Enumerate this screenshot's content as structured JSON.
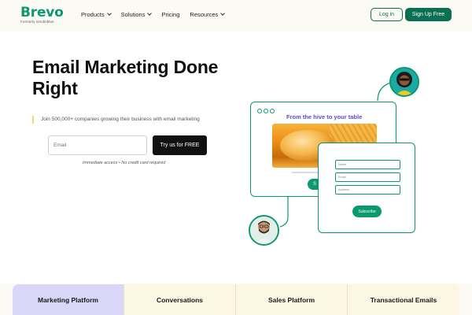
{
  "nav": {
    "logo": "Brevo",
    "logo_sub": "Formerly sendinblue",
    "menu": [
      {
        "label": "Products"
      },
      {
        "label": "Solutions"
      },
      {
        "label": "Pricing"
      },
      {
        "label": "Resources"
      }
    ],
    "login_label": "Log in",
    "signup_label": "Sign Up Free"
  },
  "hero": {
    "title": "Email Marketing Done Right",
    "tagline": "Join 500,000+ companies growing their business with email marketing",
    "email_placeholder": "Email",
    "cta_label": "Try us for FREE",
    "note": "Immediate access • No credit card required"
  },
  "illustration": {
    "card_title": "From the hive to your table",
    "card_button": "S",
    "form_fields": [
      "Name",
      "Email",
      "Address"
    ],
    "subscribe_label": "Subscribe"
  },
  "tabs": [
    {
      "label": "Marketing Platform",
      "active": true
    },
    {
      "label": "Conversations",
      "active": false
    },
    {
      "label": "Sales Platform",
      "active": false
    },
    {
      "label": "Transactional Emails",
      "active": false
    }
  ],
  "colors": {
    "brand_green": "#0b996e",
    "button_green": "#0b6f54",
    "active_tab": "#d9d6f8",
    "tab_bg": "#fcf7e2"
  }
}
